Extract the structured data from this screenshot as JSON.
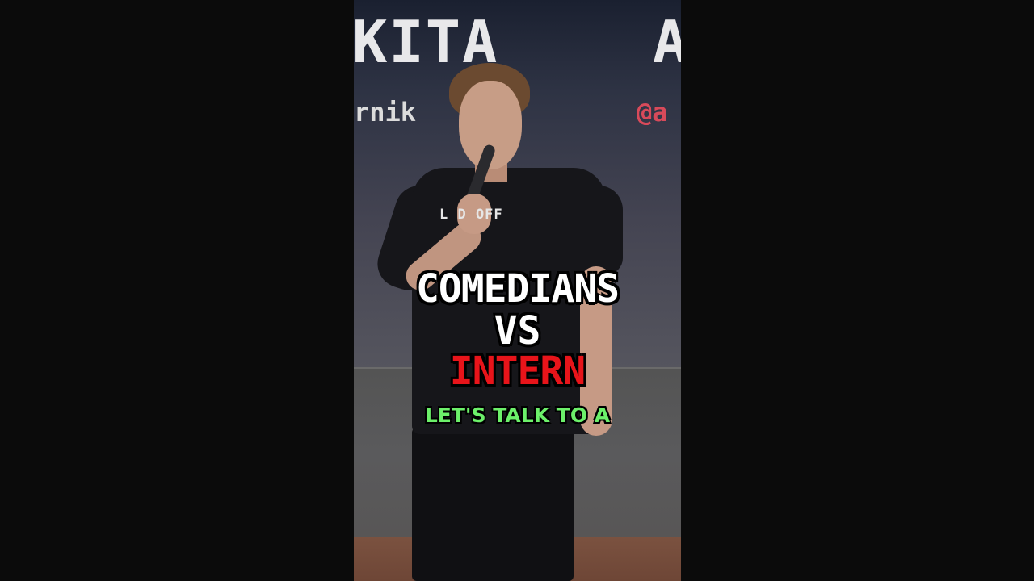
{
  "video": {
    "backdrop": {
      "name_left": "KITA",
      "name_right": "A",
      "handle_left": "rnik",
      "handle_right": "@a"
    },
    "shirt_text": "L  D OFF",
    "captions": {
      "line1": "COMEDIANS",
      "line2": "VS",
      "line3": "INTERN",
      "line3_color": "#e8141a",
      "subtitle": "LET'S TALK TO A",
      "subtitle_color": "#6cf06a"
    }
  }
}
